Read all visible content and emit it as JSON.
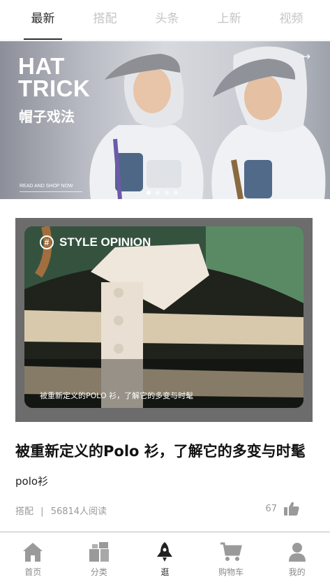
{
  "tabs": [
    {
      "label": "最新",
      "active": true
    },
    {
      "label": "搭配",
      "active": false
    },
    {
      "label": "头条",
      "active": false
    },
    {
      "label": "上新",
      "active": false
    },
    {
      "label": "视频",
      "active": false
    }
  ],
  "banner": {
    "title_line1": "HAT",
    "title_line2": "TRICK",
    "subtitle": "帽子戏法",
    "shop_text": "READ AND SHOP NOW",
    "arrow": "→",
    "slide_count": 4,
    "active_slide": 1
  },
  "article": {
    "image_badge": "STYLE OPINION",
    "image_badge_icon": "#",
    "image_caption": "被重新定义的POLO 衫，了解它的多变与时髦",
    "title": "被重新定义的Polo 衫，了解它的多变与时髦",
    "tag": "polo衫",
    "category": "搭配",
    "separator": "|",
    "reads": "56814人阅读",
    "likes": "67"
  },
  "bottom_nav": [
    {
      "label": "首页",
      "icon": "home-icon",
      "active": false
    },
    {
      "label": "分类",
      "icon": "category-icon",
      "active": false
    },
    {
      "label": "逛",
      "icon": "rocket-icon",
      "active": true
    },
    {
      "label": "购物车",
      "icon": "cart-icon",
      "active": false
    },
    {
      "label": "我的",
      "icon": "user-icon",
      "active": false
    }
  ],
  "colors": {
    "active_text": "#2b2b2b",
    "inactive_text": "#c4c4c4",
    "icon_gray": "#9a9a9a",
    "icon_active": "#222222"
  }
}
